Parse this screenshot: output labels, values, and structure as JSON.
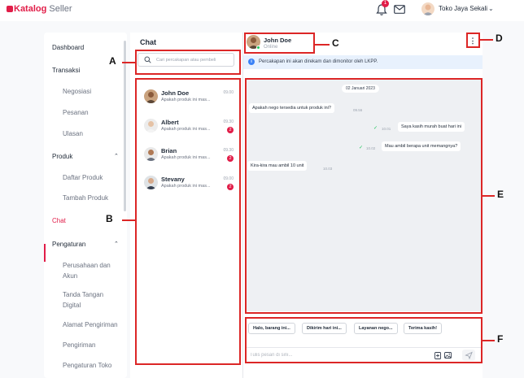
{
  "header": {
    "logo_brand": "Katalog",
    "logo_suffix": "Seller",
    "notification_count": "1",
    "store_name": "Toko Jaya Sekali"
  },
  "sidebar": {
    "items": [
      {
        "label": "Dashboard"
      },
      {
        "label": "Transaksi"
      },
      {
        "label": "Negosiasi"
      },
      {
        "label": "Pesanan"
      },
      {
        "label": "Ulasan"
      },
      {
        "label": "Produk"
      },
      {
        "label": "Daftar Produk"
      },
      {
        "label": "Tambah Produk"
      },
      {
        "label": "Chat"
      },
      {
        "label": "Pengaturan"
      },
      {
        "label": "Perusahaan dan Akun"
      },
      {
        "label": "Tanda Tangan Digital"
      },
      {
        "label": "Alamat Pengiriman"
      },
      {
        "label": "Pengiriman"
      },
      {
        "label": "Pengaturan Toko"
      }
    ],
    "active_item": "Chat"
  },
  "chat_list": {
    "title": "Chat",
    "search_placeholder": "Cari percakapan atau pembeli",
    "contacts": [
      {
        "name": "John Doe",
        "preview": "Apakah produk ini mas...",
        "time": "09.00",
        "unread": ""
      },
      {
        "name": "Albert",
        "preview": "Apakah produk ini mas...",
        "time": "09.30",
        "unread": "2"
      },
      {
        "name": "Brian",
        "preview": "Apakah produk ini mas...",
        "time": "09.30",
        "unread": "2"
      },
      {
        "name": "Stevany",
        "preview": "Apakah produk ini mas...",
        "time": "09.00",
        "unread": "2"
      }
    ]
  },
  "conversation": {
    "name": "John Doe",
    "status": "Online",
    "notice": "Percakapan ini akan direkam dan dimonitor oleh LKPP.",
    "date": "02 Januari 2023",
    "messages": [
      {
        "text": "Apakah nego tersedia untuk produk ini?",
        "time": "09.56",
        "side": "left"
      },
      {
        "text": "Saya kasih murah buat hari ini",
        "time": "10.01",
        "side": "right"
      },
      {
        "text": "Mau ambil berapa unit memangnya?",
        "time": "10.02",
        "side": "right"
      },
      {
        "text": "Kira-kira mau ambil 10 unit",
        "time": "10.03",
        "side": "left"
      }
    ],
    "quick_replies": [
      "Halo, barang ini...",
      "Dikirim hari ini...",
      "Layanan nego...",
      "Terima kasih!"
    ],
    "input_placeholder": "Tulis pesan di sini..."
  },
  "annotations": [
    "A",
    "B",
    "C",
    "D",
    "E",
    "F"
  ],
  "colors": {
    "accent": "#e11d48",
    "annotation": "#dc2626",
    "online": "#22c55e",
    "info": "#3b82f6"
  }
}
